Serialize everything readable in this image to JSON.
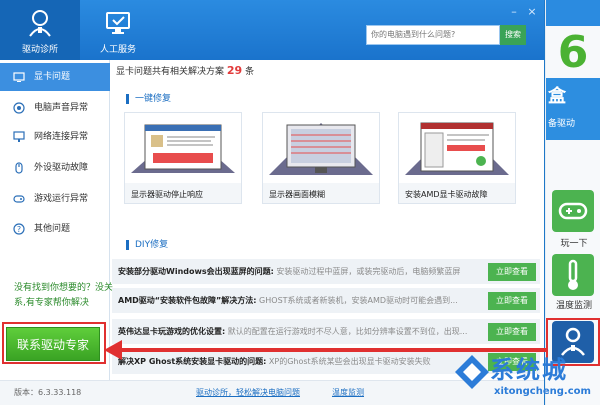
{
  "header": {
    "tabs": [
      {
        "label": "驱动诊所",
        "icon": "doctor-icon"
      },
      {
        "label": "人工服务",
        "icon": "computer-service-icon"
      }
    ],
    "search_placeholder": "你的电脑遇到什么问题?",
    "search_button": "搜索"
  },
  "sidebar": {
    "items": [
      {
        "label": "显卡问题",
        "icon": "display-icon"
      },
      {
        "label": "电脑声音异常",
        "icon": "speaker-icon"
      },
      {
        "label": "网络连接异常",
        "icon": "network-icon"
      },
      {
        "label": "外设驱动故障",
        "icon": "mouse-icon"
      },
      {
        "label": "游戏运行异常",
        "icon": "gamepad-icon"
      },
      {
        "label": "其他问题",
        "icon": "question-icon"
      }
    ],
    "help_text": "没有找到你想要的？没关系,有专家帮你解决",
    "expert_button": "联系驱动专家"
  },
  "content": {
    "summary_prefix": "显卡问题共有相关解决方案",
    "summary_count": "29",
    "summary_suffix": "条",
    "quick_fix_title": "一键修复",
    "cards": [
      {
        "label": "显示器驱动停止响应"
      },
      {
        "label": "显示器画面模糊"
      },
      {
        "label": "安装AMD显卡驱动故障"
      }
    ],
    "diy_title": "DIY修复",
    "diy_rows": [
      {
        "title": "安装部分驱动Windows会出现蓝屏的问题:",
        "desc": " 安装驱动过程中蓝屏，或装完驱动后，电脑频繁蓝屏",
        "button": "立即查看"
      },
      {
        "title": "AMD驱动“安装软件包故障”解决方法:",
        "desc": " GHOST系统或者新装机，安装AMD驱动时可能会遇到...",
        "button": "立即查看"
      },
      {
        "title": "英伟达显卡玩游戏的优化设置:",
        "desc": " 默认的配置在运行游戏时不尽人意，比如分辨率设置不到位，出现...",
        "button": "立即查看"
      },
      {
        "title": "解决XP Ghost系统安装显卡驱动的问题:",
        "desc": " XP的Ghost系统某些会出现显卡驱动安装失败",
        "button": "立即查看"
      }
    ]
  },
  "footer": {
    "version": "版本：6.3.33.118",
    "link1": "驱动诊所，轻松解决电脑问题",
    "link2": "温度监测"
  },
  "right_panel": {
    "band_text_1": "盒",
    "band_text_2": "备驱动",
    "tools": [
      {
        "label": "玩一下",
        "icon": "gamepad-icon"
      },
      {
        "label": "温度监测",
        "icon": "thermometer-icon"
      },
      {
        "label": "",
        "icon": "doctor-icon"
      }
    ]
  },
  "watermark": {
    "text": "系统城",
    "url": "xitongcheng.com"
  },
  "colors": {
    "header_blue": "#1a73cc",
    "accent_green": "#4cb350",
    "highlight_red": "#e03030",
    "count_red": "#e23b3b"
  }
}
